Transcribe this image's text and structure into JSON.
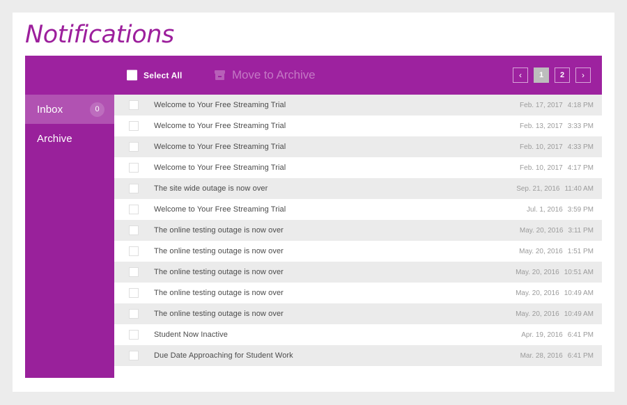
{
  "page": {
    "title": "Notifications",
    "background_color": "#ececec",
    "accent_color": "#9d229f"
  },
  "toolbar": {
    "select_all_label": "Select All",
    "select_all_icon": "checkbox-icon",
    "move_to_archive_label": "Move to Archive",
    "move_to_archive_icon": "archive-box-icon",
    "move_to_archive_disabled": true,
    "pagination": {
      "prev_label": "‹",
      "next_label": "›",
      "pages": [
        "1",
        "2"
      ],
      "active_page": "1"
    }
  },
  "sidebar": {
    "items": [
      {
        "label": "Inbox",
        "badge": "0",
        "active": true
      },
      {
        "label": "Archive",
        "badge": "",
        "active": false
      }
    ]
  },
  "notifications": [
    {
      "title": "Welcome to Your Free Streaming Trial",
      "date": "Feb. 17, 2017",
      "time": "4:18 PM"
    },
    {
      "title": "Welcome to Your Free Streaming Trial",
      "date": "Feb. 13, 2017",
      "time": "3:33 PM"
    },
    {
      "title": "Welcome to Your Free Streaming Trial",
      "date": "Feb. 10, 2017",
      "time": "4:33 PM"
    },
    {
      "title": "Welcome to Your Free Streaming Trial",
      "date": "Feb. 10, 2017",
      "time": "4:17 PM"
    },
    {
      "title": "The site wide outage is now over",
      "date": "Sep. 21, 2016",
      "time": "11:40 AM"
    },
    {
      "title": "Welcome to Your Free Streaming Trial",
      "date": "Jul. 1, 2016",
      "time": "3:59 PM"
    },
    {
      "title": "The online testing outage is now over",
      "date": "May. 20, 2016",
      "time": "3:11 PM"
    },
    {
      "title": "The online testing outage is now over",
      "date": "May. 20, 2016",
      "time": "1:51 PM"
    },
    {
      "title": "The online testing outage is now over",
      "date": "May. 20, 2016",
      "time": "10:51 AM"
    },
    {
      "title": "The online testing outage is now over",
      "date": "May. 20, 2016",
      "time": "10:49 AM"
    },
    {
      "title": "The online testing outage is now over",
      "date": "May. 20, 2016",
      "time": "10:49 AM"
    },
    {
      "title": "Student Now Inactive",
      "date": "Apr. 19, 2016",
      "time": "6:41 PM"
    },
    {
      "title": "Due Date Approaching for Student Work",
      "date": "Mar. 28, 2016",
      "time": "6:41 PM"
    }
  ]
}
